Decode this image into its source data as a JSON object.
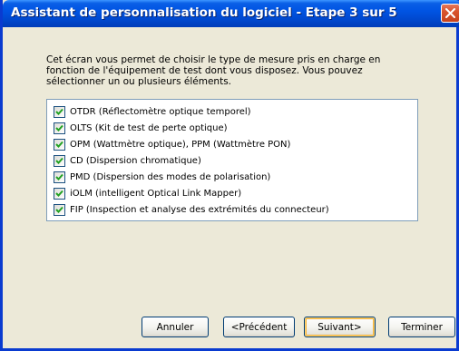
{
  "window": {
    "title": "Assistant de personnalisation du logiciel - Etape 3 sur 5"
  },
  "intro": {
    "lines": [
      "Cet écran vous permet de choisir le type de mesure pris en charge en",
      "fonction de l'équipement de test dont vous disposez. Vous pouvez",
      "sélectionner un ou plusieurs éléments."
    ]
  },
  "measurements": {
    "items": [
      {
        "label": "OTDR (Réflectomètre optique temporel)",
        "checked": true
      },
      {
        "label": "OLTS (Kit de test de perte optique)",
        "checked": true
      },
      {
        "label": "OPM (Wattmètre optique), PPM (Wattmètre PON)",
        "checked": true
      },
      {
        "label": "CD (Dispersion chromatique)",
        "checked": true
      },
      {
        "label": "PMD (Dispersion des modes de polarisation)",
        "checked": true
      },
      {
        "label": "iOLM (intelligent Optical Link Mapper)",
        "checked": true
      },
      {
        "label": "FIP (Inspection et analyse des extrémités du connecteur)",
        "checked": true
      }
    ]
  },
  "buttons": {
    "cancel": "Annuler",
    "previous": "<Précédent",
    "next": "Suivant>",
    "finish": "Terminer"
  },
  "icons": {
    "close": "close-icon",
    "checkbox": "checkmark-icon"
  },
  "colors": {
    "titlebar": "#0054e3",
    "close_button": "#d8542e",
    "dialog_background": "#ece9d8",
    "checkmark": "#21a121"
  }
}
